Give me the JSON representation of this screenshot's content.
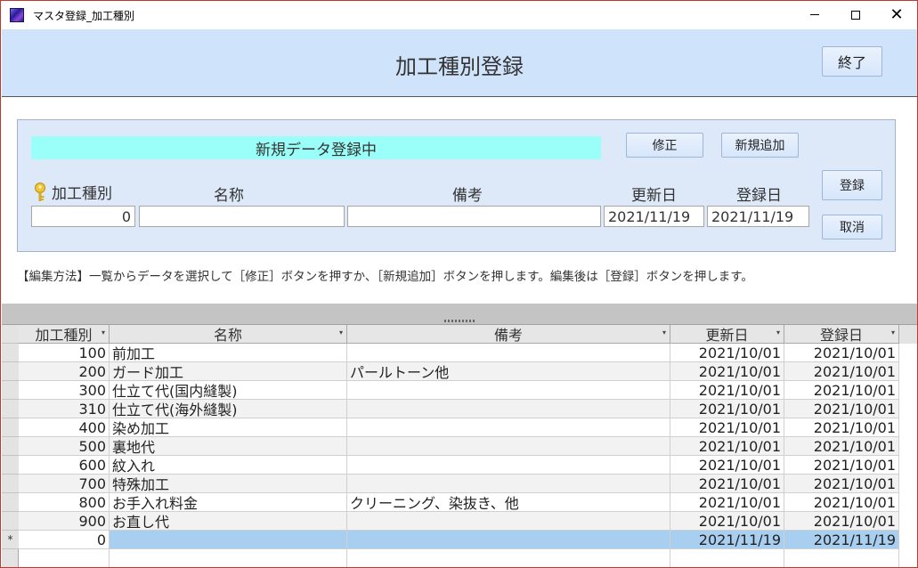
{
  "window": {
    "title": "マスタ登録_加工種別",
    "minimize": "—",
    "maximize": "",
    "close": "✕"
  },
  "header": {
    "form_title": "加工種別登録",
    "exit_label": "終了"
  },
  "panel": {
    "status": "新規データ登録中",
    "edit_label": "修正",
    "new_label": "新規追加",
    "register_label": "登録",
    "cancel_label": "取消",
    "labels": {
      "code": "加工種別",
      "name": "名称",
      "note": "備考",
      "updated": "更新日",
      "registered": "登録日"
    },
    "fields": {
      "code": "0",
      "name": "",
      "note": "",
      "updated": "2021/11/19",
      "registered": "2021/11/19"
    }
  },
  "instructions": "【編集方法】一覧からデータを選択して［修正］ボタンを押すか、［新規追加］ボタンを押します。編集後は［登録］ボタンを押します。",
  "grid": {
    "headers": [
      "加工種別",
      "名称",
      "備考",
      "更新日",
      "登録日"
    ],
    "rows": [
      {
        "code": "100",
        "name": "前加工",
        "note": "",
        "updated": "2021/10/01",
        "registered": "2021/10/01"
      },
      {
        "code": "200",
        "name": "ガード加工",
        "note": "パールトーン他",
        "updated": "2021/10/01",
        "registered": "2021/10/01"
      },
      {
        "code": "300",
        "name": "仕立て代(国内縫製)",
        "note": "",
        "updated": "2021/10/01",
        "registered": "2021/10/01"
      },
      {
        "code": "310",
        "name": "仕立て代(海外縫製)",
        "note": "",
        "updated": "2021/10/01",
        "registered": "2021/10/01"
      },
      {
        "code": "400",
        "name": "染め加工",
        "note": "",
        "updated": "2021/10/01",
        "registered": "2021/10/01"
      },
      {
        "code": "500",
        "name": "裏地代",
        "note": "",
        "updated": "2021/10/01",
        "registered": "2021/10/01"
      },
      {
        "code": "600",
        "name": "紋入れ",
        "note": "",
        "updated": "2021/10/01",
        "registered": "2021/10/01"
      },
      {
        "code": "700",
        "name": "特殊加工",
        "note": "",
        "updated": "2021/10/01",
        "registered": "2021/10/01"
      },
      {
        "code": "800",
        "name": "お手入れ料金",
        "note": "クリーニング、染抜き、他",
        "updated": "2021/10/01",
        "registered": "2021/10/01"
      },
      {
        "code": "900",
        "name": "お直し代",
        "note": "",
        "updated": "2021/10/01",
        "registered": "2021/10/01"
      }
    ],
    "new_row": {
      "marker": "*",
      "code": "0",
      "name": "",
      "note": "",
      "updated": "2021/11/19",
      "registered": "2021/11/19"
    }
  }
}
